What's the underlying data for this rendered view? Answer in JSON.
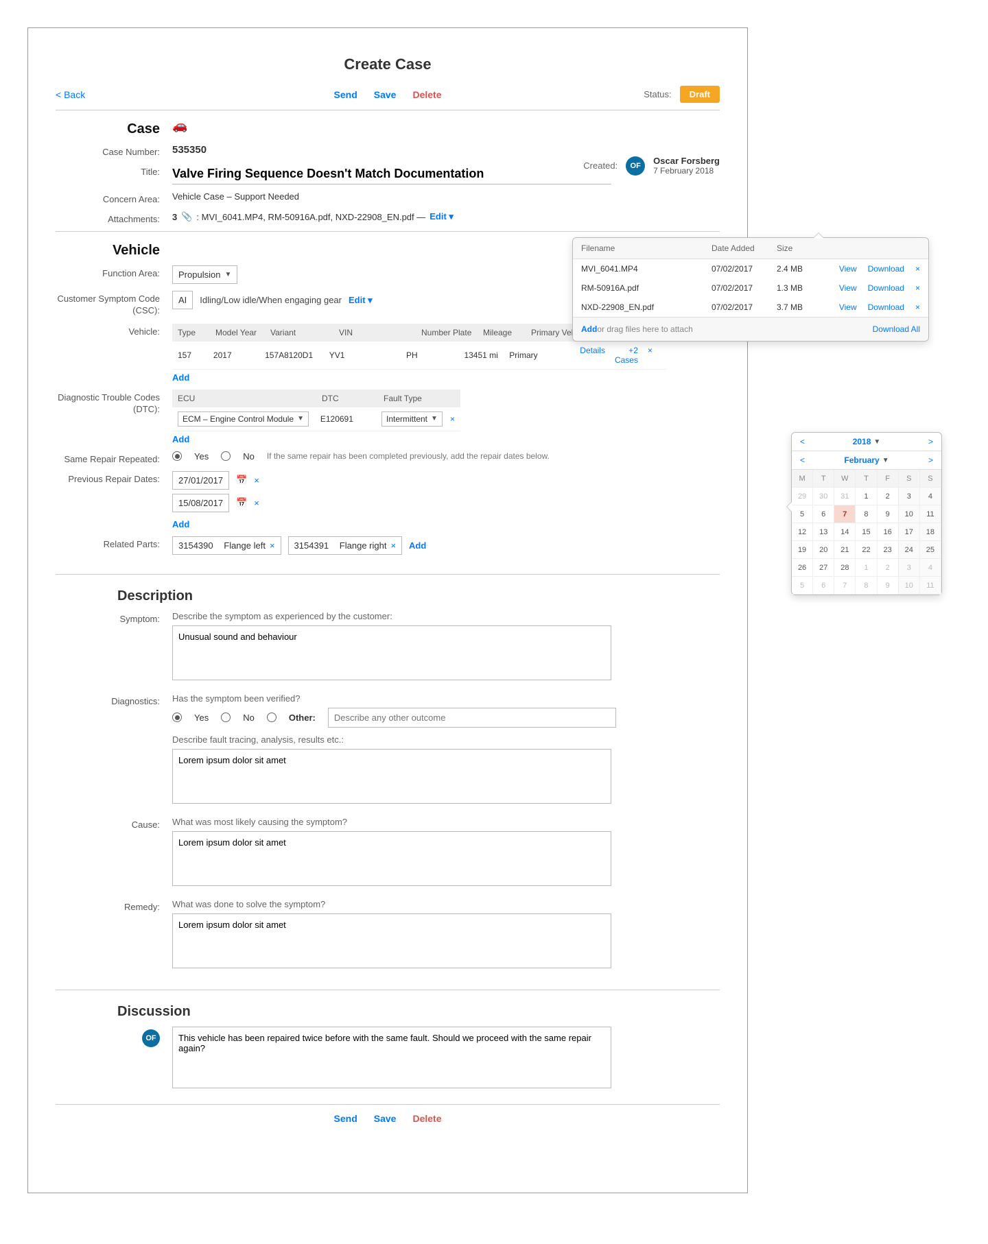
{
  "page": {
    "title": "Create Case",
    "back": "< Back"
  },
  "actions": {
    "send": "Send",
    "save": "Save",
    "delete": "Delete"
  },
  "status": {
    "label": "Status:",
    "value": "Draft"
  },
  "labels": {
    "case": "Case",
    "case_number": "Case Number:",
    "title": "Title:",
    "concern_area": "Concern Area:",
    "attachments": "Attachments:",
    "vehicle": "Vehicle",
    "function_area": "Function Area:",
    "csc": "Customer Symptom Code (CSC):",
    "vehicle_field": "Vehicle:",
    "dtc": "Diagnostic Trouble Codes (DTC):",
    "same_repair": "Same Repair Repeated:",
    "prev_repair": "Previous Repair Dates:",
    "related_parts": "Related Parts:",
    "description": "Description",
    "symptom": "Symptom:",
    "diagnostics": "Diagnostics:",
    "cause": "Cause:",
    "remedy": "Remedy:",
    "discussion": "Discussion",
    "created": "Created:",
    "add": "Add",
    "edit": "Edit ▾",
    "details": "Details",
    "plus_cases": "+2 Cases",
    "yes": "Yes",
    "no": "No",
    "other": "Other:"
  },
  "case": {
    "number": "535350",
    "title": "Valve Firing Sequence Doesn't Match Documentation",
    "concern_area": "Vehicle Case – Support Needed",
    "attachments_count": "3",
    "attachments_summary": ": MVI_6041.MP4, RM-50916A.pdf, NXD-22908_EN.pdf  —"
  },
  "created": {
    "initials": "OF",
    "name": "Oscar Forsberg",
    "date": "7 February 2018"
  },
  "vehicle": {
    "function_area": "Propulsion",
    "csc_code": "AI",
    "csc_desc": "Idling/Low idle/When engaging gear",
    "headers": {
      "type": "Type",
      "my": "Model Year",
      "variant": "Variant",
      "vin": "VIN",
      "np": "Number Plate",
      "mi": "Mileage",
      "pv": "Primary Vehicle"
    },
    "row": {
      "type": "157",
      "my": "2017",
      "variant": "157A8120D1",
      "vin": "YV1",
      "np": "PH",
      "mi": "13451 mi",
      "pv": "Primary"
    }
  },
  "dtc": {
    "headers": {
      "ecu": "ECU",
      "dtc": "DTC",
      "ft": "Fault Type"
    },
    "row": {
      "ecu": "ECM – Engine Control Module",
      "dtc": "E120691",
      "ft": "Intermittent"
    }
  },
  "same_repair_hint": "If the same repair has been completed previously, add the repair dates below.",
  "prev_dates": [
    "27/01/2017",
    "15/08/2017"
  ],
  "parts": [
    {
      "num": "3154390",
      "name": "Flange left"
    },
    {
      "num": "3154391",
      "name": "Flange right"
    }
  ],
  "description": {
    "symptom_prompt": "Describe the symptom as experienced by the customer:",
    "symptom_text": "Unusual sound and behaviour",
    "diag_prompt1": "Has the symptom been verified?",
    "other_placeholder": "Describe any other outcome",
    "diag_prompt2": "Describe fault tracing, analysis, results etc.:",
    "diag_text": "Lorem ipsum dolor sit amet",
    "cause_prompt": "What was most likely causing the symptom?",
    "cause_text": "Lorem ipsum dolor sit amet",
    "remedy_prompt": "What was done to solve the symptom?",
    "remedy_text": "Lorem ipsum dolor sit amet"
  },
  "discussion": {
    "initials": "OF",
    "text": "This vehicle has been repaired twice before with the same fault. Should we proceed with the same repair again?"
  },
  "attach_pop": {
    "headers": {
      "fn": "Filename",
      "da": "Date Added",
      "sz": "Size"
    },
    "rows": [
      {
        "fn": "MVI_6041.MP4",
        "da": "07/02/2017",
        "sz": "2.4 MB"
      },
      {
        "fn": "RM-50916A.pdf",
        "da": "07/02/2017",
        "sz": "1.3 MB"
      },
      {
        "fn": "NXD-22908_EN.pdf",
        "da": "07/02/2017",
        "sz": "3.7 MB"
      }
    ],
    "view": "View",
    "download": "Download",
    "download_all": "Download All",
    "add": "Add",
    "drag": " or drag files here to attach"
  },
  "calendar": {
    "year": "2018",
    "month": "February",
    "dow": [
      "M",
      "T",
      "W",
      "T",
      "F",
      "S",
      "S"
    ],
    "cells": [
      {
        "n": "29",
        "o": true
      },
      {
        "n": "30",
        "o": true
      },
      {
        "n": "31",
        "o": true
      },
      {
        "n": "1"
      },
      {
        "n": "2"
      },
      {
        "n": "3",
        "w": true
      },
      {
        "n": "4",
        "w": true
      },
      {
        "n": "5"
      },
      {
        "n": "6"
      },
      {
        "n": "7",
        "sel": true
      },
      {
        "n": "8"
      },
      {
        "n": "9"
      },
      {
        "n": "10",
        "w": true
      },
      {
        "n": "11",
        "w": true
      },
      {
        "n": "12"
      },
      {
        "n": "13"
      },
      {
        "n": "14"
      },
      {
        "n": "15"
      },
      {
        "n": "16"
      },
      {
        "n": "17",
        "w": true
      },
      {
        "n": "18",
        "w": true
      },
      {
        "n": "19"
      },
      {
        "n": "20"
      },
      {
        "n": "21"
      },
      {
        "n": "22"
      },
      {
        "n": "23"
      },
      {
        "n": "24",
        "w": true
      },
      {
        "n": "25",
        "w": true
      },
      {
        "n": "26"
      },
      {
        "n": "27"
      },
      {
        "n": "28"
      },
      {
        "n": "1",
        "o": true
      },
      {
        "n": "2",
        "o": true
      },
      {
        "n": "3",
        "o": true,
        "w": true
      },
      {
        "n": "4",
        "o": true,
        "w": true
      },
      {
        "n": "5",
        "o": true
      },
      {
        "n": "6",
        "o": true
      },
      {
        "n": "7",
        "o": true
      },
      {
        "n": "8",
        "o": true
      },
      {
        "n": "9",
        "o": true
      },
      {
        "n": "10",
        "o": true,
        "w": true
      },
      {
        "n": "11",
        "o": true,
        "w": true
      }
    ]
  }
}
